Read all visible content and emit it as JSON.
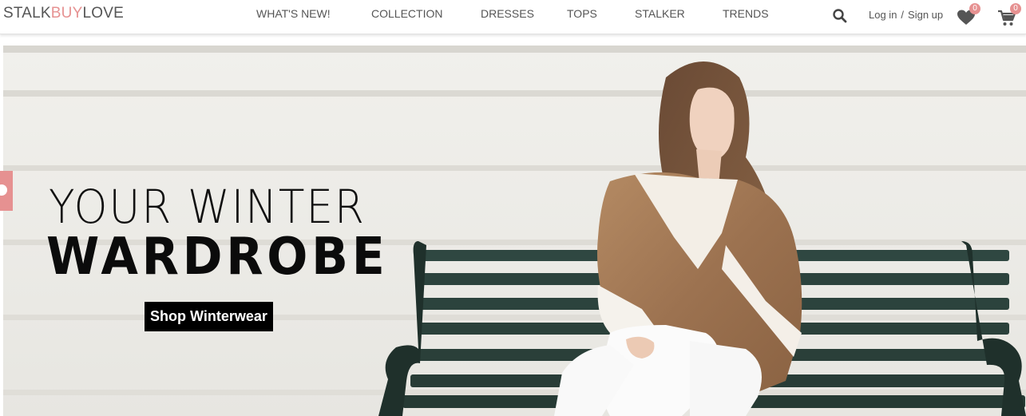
{
  "brand": {
    "stalk": "STALK",
    "buy": "BUY",
    "love": "LOVE",
    "accent_color": "#e69191"
  },
  "nav": {
    "items": [
      {
        "label": "WHAT'S NEW!"
      },
      {
        "label": "COLLECTION"
      },
      {
        "label": "DRESSES"
      },
      {
        "label": "TOPS"
      },
      {
        "label": "STALKER"
      },
      {
        "label": "TRENDS"
      }
    ]
  },
  "header": {
    "search_icon": "search-icon",
    "login_label": "Log in",
    "separator": "/",
    "signup_label": "Sign up",
    "wishlist_icon": "heart-icon",
    "wishlist_count": "0",
    "cart_icon": "cart-icon",
    "cart_count": "0"
  },
  "hero": {
    "line1": "YOUR WINTER",
    "line2": "WARDROBE",
    "cta_label": "Shop Winterwear"
  },
  "side_tab": {
    "icon": "feedback-tab-icon"
  }
}
